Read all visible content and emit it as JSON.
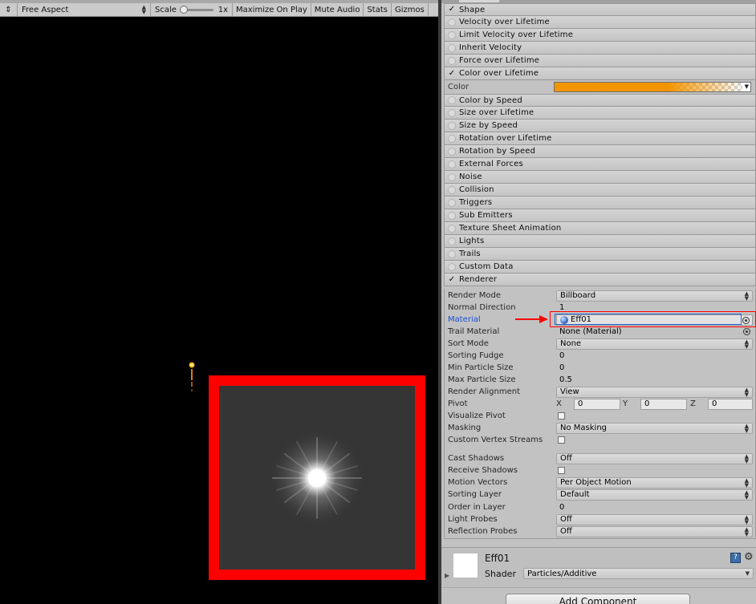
{
  "game_toolbar": {
    "display_arrows": "⇕",
    "aspect": "Free Aspect",
    "scale_label": "Scale",
    "scale_value": "1x",
    "maximize_on_play": "Maximize On Play",
    "mute_audio": "Mute Audio",
    "stats": "Stats",
    "gizmos": "Gizmos"
  },
  "modules": [
    {
      "label": "Shape",
      "enabled": true
    },
    {
      "label": "Velocity over Lifetime",
      "enabled": false
    },
    {
      "label": "Limit Velocity over Lifetime",
      "enabled": false
    },
    {
      "label": "Inherit Velocity",
      "enabled": false
    },
    {
      "label": "Force over Lifetime",
      "enabled": false
    },
    {
      "label": "Color over Lifetime",
      "enabled": true
    }
  ],
  "color_row": {
    "label": "Color",
    "gradient_color": "#f39500"
  },
  "modules2": [
    {
      "label": "Color by Speed",
      "enabled": false
    },
    {
      "label": "Size over Lifetime",
      "enabled": false
    },
    {
      "label": "Size by Speed",
      "enabled": false
    },
    {
      "label": "Rotation over Lifetime",
      "enabled": false
    },
    {
      "label": "Rotation by Speed",
      "enabled": false
    },
    {
      "label": "External Forces",
      "enabled": false
    },
    {
      "label": "Noise",
      "enabled": false
    },
    {
      "label": "Collision",
      "enabled": false
    },
    {
      "label": "Triggers",
      "enabled": false
    },
    {
      "label": "Sub Emitters",
      "enabled": false
    },
    {
      "label": "Texture Sheet Animation",
      "enabled": false
    },
    {
      "label": "Lights",
      "enabled": false
    },
    {
      "label": "Trails",
      "enabled": false
    },
    {
      "label": "Custom Data",
      "enabled": false
    },
    {
      "label": "Renderer",
      "enabled": true
    }
  ],
  "renderer": {
    "render_mode": {
      "label": "Render Mode",
      "value": "Billboard"
    },
    "normal_direction": {
      "label": "Normal Direction",
      "value": "1"
    },
    "material": {
      "label": "Material",
      "value": "Eff01"
    },
    "trail_material": {
      "label": "Trail Material",
      "value": "None (Material)"
    },
    "sort_mode": {
      "label": "Sort Mode",
      "value": "None"
    },
    "sorting_fudge": {
      "label": "Sorting Fudge",
      "value": "0"
    },
    "min_particle_size": {
      "label": "Min Particle Size",
      "value": "0"
    },
    "max_particle_size": {
      "label": "Max Particle Size",
      "value": "0.5"
    },
    "render_alignment": {
      "label": "Render Alignment",
      "value": "View"
    },
    "pivot": {
      "label": "Pivot",
      "x_label": "X",
      "x": "0",
      "y_label": "Y",
      "y": "0",
      "z_label": "Z",
      "z": "0"
    },
    "visualize_pivot": {
      "label": "Visualize Pivot"
    },
    "masking": {
      "label": "Masking",
      "value": "No Masking"
    },
    "custom_vertex_streams": {
      "label": "Custom Vertex Streams"
    },
    "cast_shadows": {
      "label": "Cast Shadows",
      "value": "Off"
    },
    "receive_shadows": {
      "label": "Receive Shadows"
    },
    "motion_vectors": {
      "label": "Motion Vectors",
      "value": "Per Object Motion"
    },
    "sorting_layer": {
      "label": "Sorting Layer",
      "value": "Default"
    },
    "order_in_layer": {
      "label": "Order in Layer",
      "value": "0"
    },
    "light_probes": {
      "label": "Light Probes",
      "value": "Off"
    },
    "reflection_probes": {
      "label": "Reflection Probes",
      "value": "Off"
    }
  },
  "material_section": {
    "name": "Eff01",
    "shader_label": "Shader",
    "shader_value": "Particles/Additive",
    "help_glyph": "?",
    "gear_glyph": "⚙"
  },
  "add_component": "Add Component",
  "colors": {
    "highlight": "#ff0000",
    "preview_bg": "#353535",
    "accent_blue": "#1a4fd4"
  }
}
